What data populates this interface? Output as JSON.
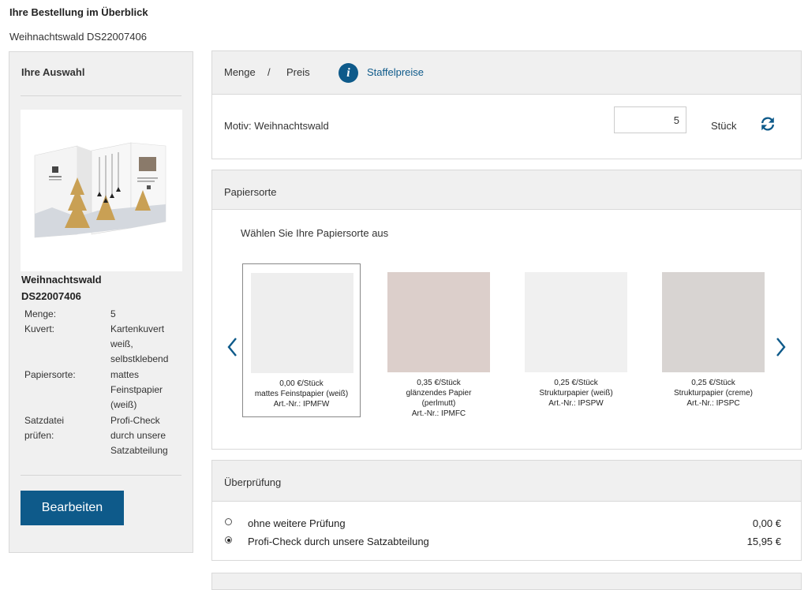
{
  "page": {
    "title": "Ihre Bestellung im Überblick",
    "subtitle": "Weihnachtswald DS22007406"
  },
  "sidebar": {
    "title": "Ihre Auswahl",
    "product_name": "Weihnachtswald",
    "product_code": "DS22007406",
    "details": [
      {
        "label": "Menge:",
        "value": "5"
      },
      {
        "label": "Kuvert:",
        "value_lines": [
          "Kartenkuvert",
          "weiß,",
          "selbstklebend"
        ]
      },
      {
        "label": "Papiersorte:",
        "value_lines": [
          "mattes",
          "Feinstpapier",
          "(weiß)"
        ]
      },
      {
        "label_lines": [
          "Satzdatei",
          "prüfen:"
        ],
        "value_lines": [
          "Profi-Check",
          "durch unsere",
          "Satzabteilung"
        ]
      }
    ],
    "edit_button": "Bearbeiten"
  },
  "quantity_panel": {
    "menge_label": "Menge",
    "separator": "/",
    "preis_label": "Preis",
    "info_glyph": "i",
    "staffelpreise_link": "Staffelpreise",
    "motiv_label": "Motiv: Weihnachtswald",
    "quantity_value": "5",
    "unit_label": "Stück",
    "refresh_icon": "refresh-icon"
  },
  "paper_panel": {
    "title": "Papiersorte",
    "instruction": "Wählen Sie Ihre Papiersorte aus",
    "options": [
      {
        "price": "0,00 €/Stück",
        "name_lines": [
          "mattes Feinstpapier (weiß)"
        ],
        "article": "Art.-Nr.: IPMFW",
        "color": "#eeeeee",
        "selected": true
      },
      {
        "price": "0,35 €/Stück",
        "name_lines": [
          "glänzendes Papier",
          "(perlmutt)"
        ],
        "article": "Art.-Nr.: IPMFC",
        "color": "#dccfcb",
        "selected": false
      },
      {
        "price": "0,25 €/Stück",
        "name_lines": [
          "Strukturpapier (weiß)"
        ],
        "article": "Art.-Nr.: IPSPW",
        "color": "#f0f0f0",
        "selected": false
      },
      {
        "price": "0,25 €/Stück",
        "name_lines": [
          "Strukturpapier (creme)"
        ],
        "article": "Art.-Nr.: IPSPC",
        "color": "#d8d4d2",
        "selected": false
      }
    ]
  },
  "check_panel": {
    "title": "Überprüfung",
    "options": [
      {
        "label": "ohne weitere Prüfung",
        "price": "0,00 €",
        "checked": false
      },
      {
        "label": "Profi-Check durch unsere Satzabteilung",
        "price": "15,95 €",
        "checked": true
      }
    ]
  },
  "colors": {
    "accent": "#0e5a8a",
    "gold": "#c9a054",
    "panel_header": "#f0f0f0"
  }
}
